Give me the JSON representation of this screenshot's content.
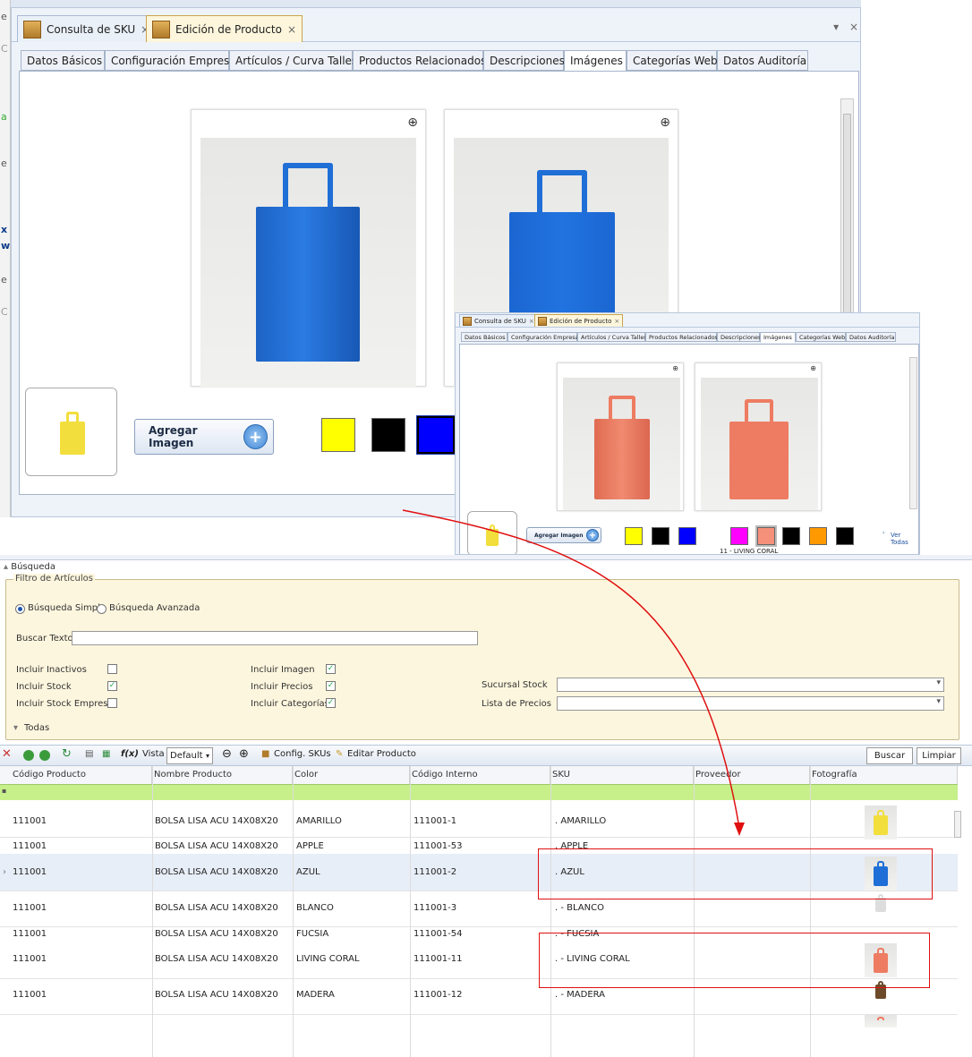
{
  "doc_tabs": [
    {
      "label": "Consulta de SKU"
    },
    {
      "label": "Edición de Producto"
    }
  ],
  "close_glyph": "×",
  "tabs": [
    {
      "label": "Datos Básicos"
    },
    {
      "label": "Configuración Empresa"
    },
    {
      "label": "Artículos / Curva Talles"
    },
    {
      "label": "Productos Relacionados"
    },
    {
      "label": "Descripciones"
    },
    {
      "label": "Imágenes"
    },
    {
      "label": "Categorías Web"
    },
    {
      "label": "Datos Auditoría"
    }
  ],
  "add_image_label": "Agregar Imagen",
  "swatches_main": [
    "#ffff00",
    "#000000",
    "#0000ff"
  ],
  "swatches_small": [
    "#ffff00",
    "#000000",
    "#0000ff",
    "#ff00ff",
    "#f5907a",
    "#000000",
    "#ff9900",
    "#000000"
  ],
  "see_all": "Ver Todas",
  "selected_color_caption": "11 - LIVING CORAL",
  "search": {
    "section": "Búsqueda",
    "filter_legend": "Filtro de Artículos",
    "mode_simple": "Búsqueda Simple",
    "mode_advanced": "Búsqueda Avanzada",
    "search_text_label": "Buscar Texto",
    "incl_inactivos": "Incluir Inactivos",
    "incl_stock": "Incluir Stock",
    "incl_stock_empresa": "Incluir Stock Empresa",
    "incl_imagen": "Incluir Imagen",
    "incl_precios": "Incluir Precios",
    "incl_categorias": "Incluir Categorías",
    "sucursal": "Sucursal Stock",
    "lista": "Lista de Precios",
    "todas": "Todas"
  },
  "toolbar": {
    "vista_label": "Vista",
    "vista_value": "Default",
    "config_label": "Config. SKUs",
    "edit_label": "Editar Producto",
    "buscar": "Buscar",
    "limpiar": "Limpiar"
  },
  "grid": {
    "columns": [
      "Código Producto",
      "Nombre Producto",
      "Color",
      "Código Interno",
      "SKU",
      "Proveedor",
      "Fotografía"
    ],
    "rows": [
      {
        "code": "111001",
        "name": "BOLSA LISA ACU 14X08X20",
        "color": "AMARILLO",
        "internal": "111001-1",
        "sku": ". AMARILLO"
      },
      {
        "code": "111001",
        "name": "BOLSA LISA ACU 14X08X20",
        "color": "APPLE",
        "internal": "111001-53",
        "sku": ". APPLE"
      },
      {
        "code": "111001",
        "name": "BOLSA LISA ACU 14X08X20",
        "color": "AZUL",
        "internal": "111001-2",
        "sku": ". AZUL"
      },
      {
        "code": "111001",
        "name": "BOLSA LISA ACU 14X08X20",
        "color": "BLANCO",
        "internal": "111001-3",
        "sku": ". - BLANCO"
      },
      {
        "code": "111001",
        "name": "BOLSA LISA ACU 14X08X20",
        "color": "FUCSIA",
        "internal": "111001-54",
        "sku": ". - FUCSIA"
      },
      {
        "code": "111001",
        "name": "BOLSA LISA ACU 14X08X20",
        "color": "LIVING CORAL",
        "internal": "111001-11",
        "sku": ". - LIVING CORAL"
      },
      {
        "code": "111001",
        "name": "BOLSA LISA ACU 14X08X20",
        "color": "MADERA",
        "internal": "111001-12",
        "sku": ". - MADERA"
      }
    ]
  },
  "colors": {
    "bag_blue": "#1f6fd6",
    "bag_coral": "#ee7c62",
    "bag_yellow": "#f2de3c",
    "annotation_red": "#e01010"
  }
}
